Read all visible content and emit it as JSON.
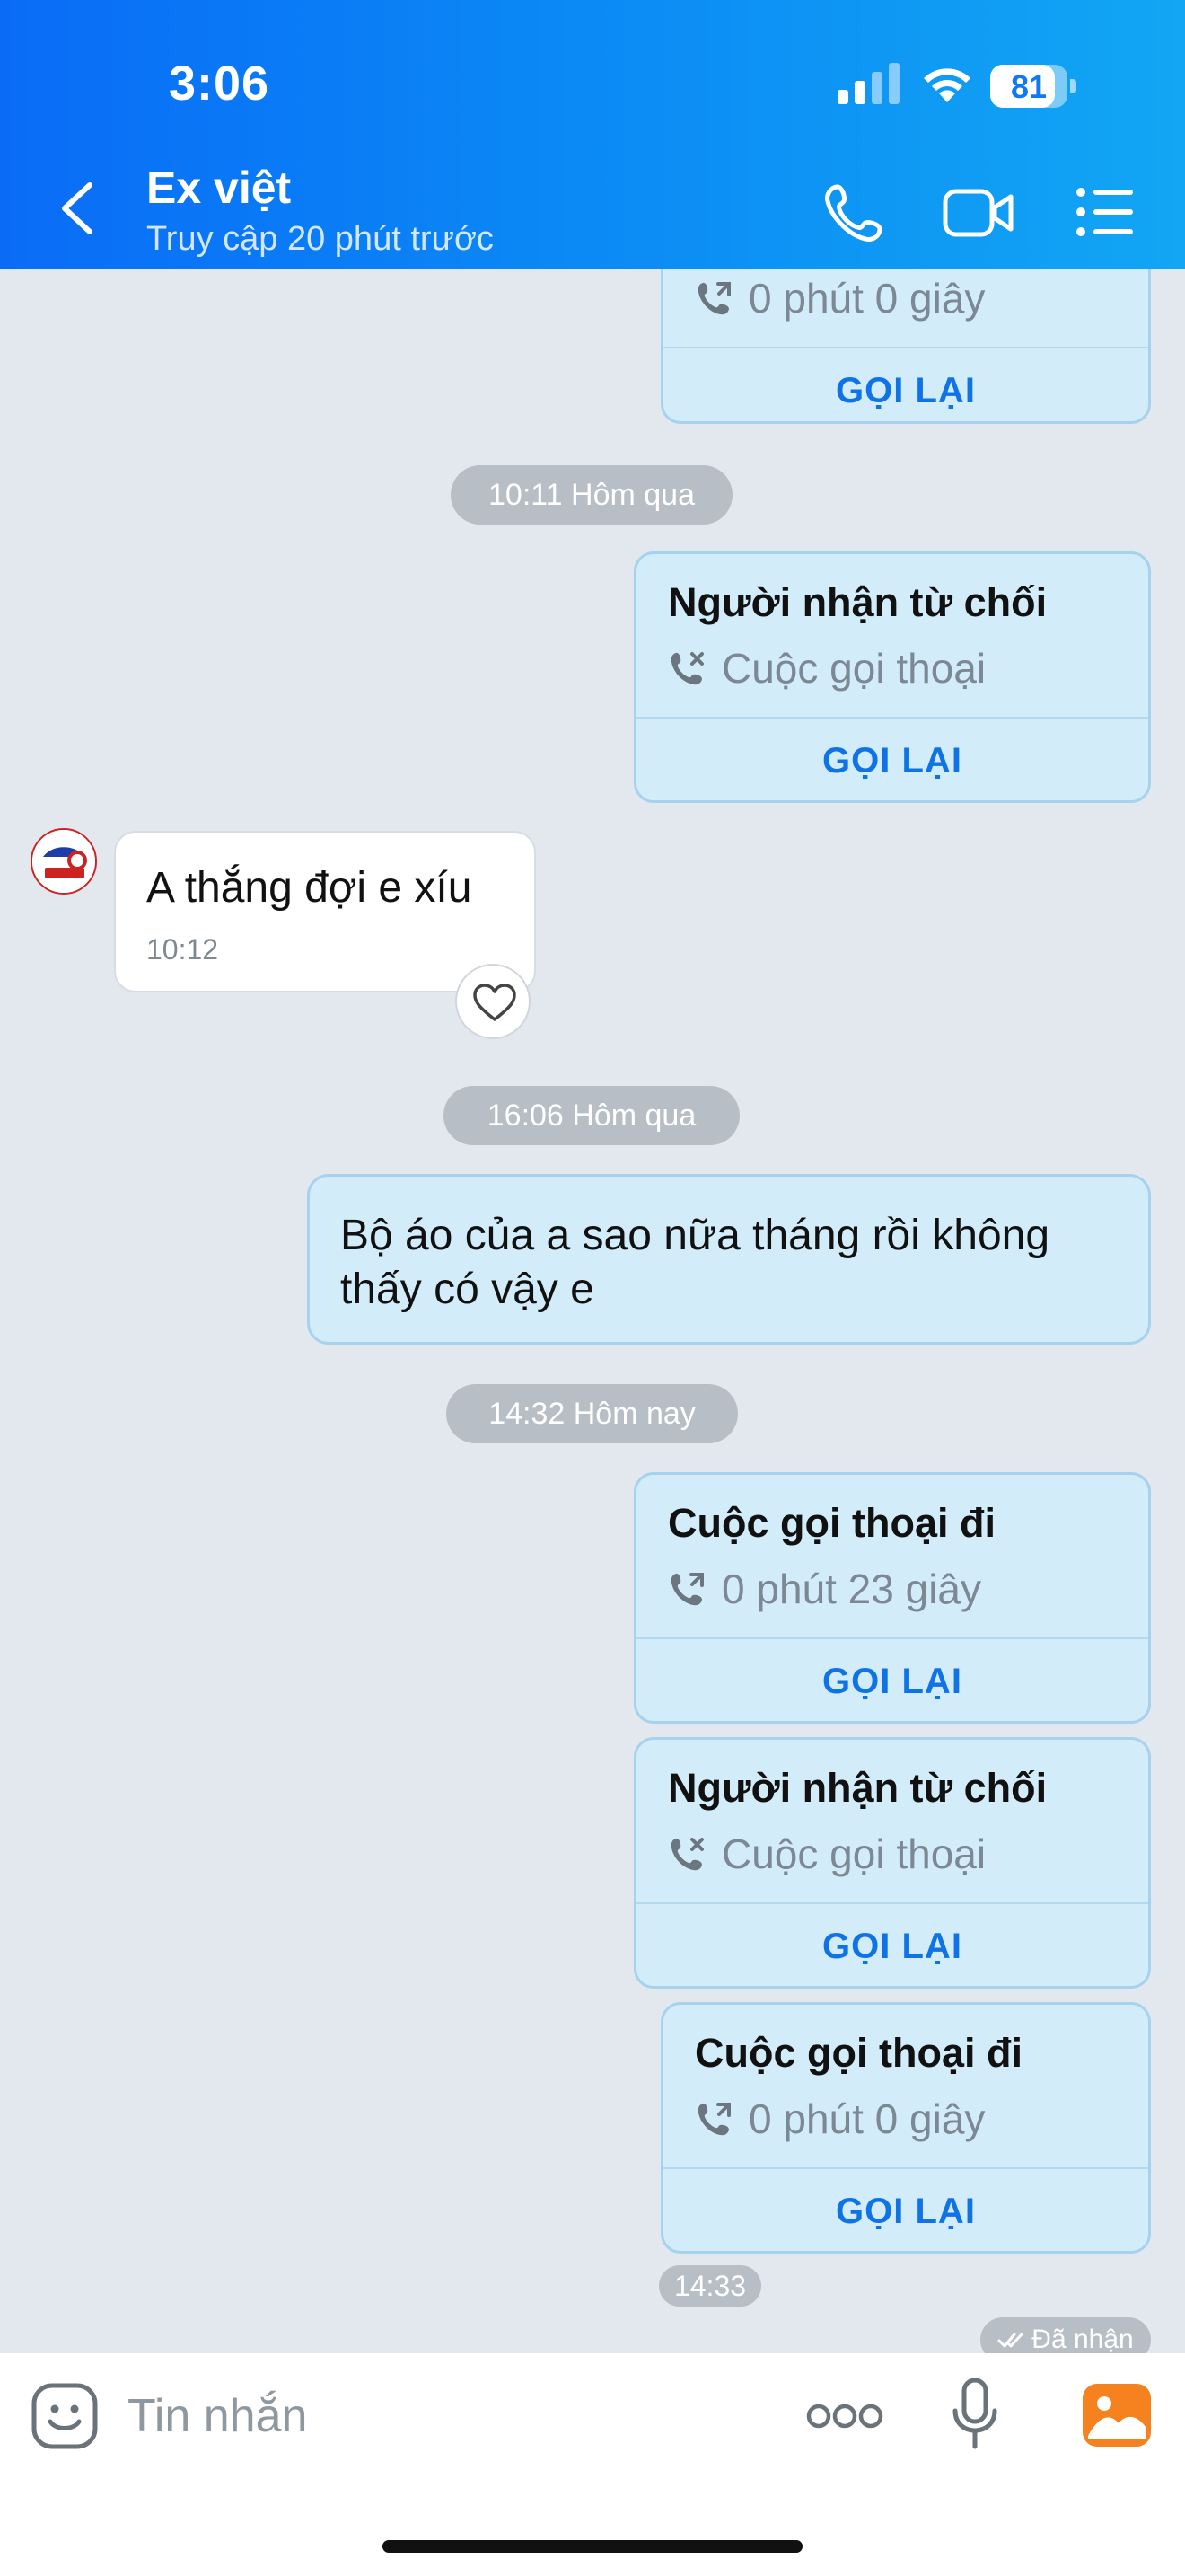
{
  "status_bar": {
    "time": "3:06",
    "battery": "81"
  },
  "header": {
    "contact_name": "Ex việt",
    "last_seen": "Truy cập 20 phút trước"
  },
  "messages": {
    "call_top": {
      "detail": "0 phút 0 giây",
      "callback": "GỌI LẠI"
    },
    "pill1": "10:11 Hôm qua",
    "call_rejected_1": {
      "title": "Người nhận từ chối",
      "detail": "Cuộc gọi thoại",
      "callback": "GỌI LẠI"
    },
    "incoming_msg": {
      "text": "A thắng đợi e xíu",
      "time": "10:12"
    },
    "pill2": "16:06 Hôm qua",
    "outgoing_msg": {
      "text": "Bộ áo của a sao nữa tháng rồi không thấy có vậy e"
    },
    "pill3": "14:32 Hôm nay",
    "call_out_1": {
      "title": "Cuộc gọi thoại đi",
      "detail": "0 phút 23 giây",
      "callback": "GỌI LẠI"
    },
    "call_rejected_2": {
      "title": "Người nhận từ chối",
      "detail": "Cuộc gọi thoại",
      "callback": "GỌI LẠI"
    },
    "call_out_2": {
      "title": "Cuộc gọi thoại đi",
      "detail": "0 phút 0 giây",
      "callback": "GỌI LẠI"
    },
    "last_time": "14:33",
    "status": "Đã nhận"
  },
  "composer": {
    "placeholder": "Tin nhắn"
  },
  "colors": {
    "header_start": "#0a6cf6",
    "header_end": "#12a6f4",
    "accent": "#0f73e6",
    "bubble_out": "#d3ecfa",
    "chat_bg": "#e3e8ef"
  }
}
